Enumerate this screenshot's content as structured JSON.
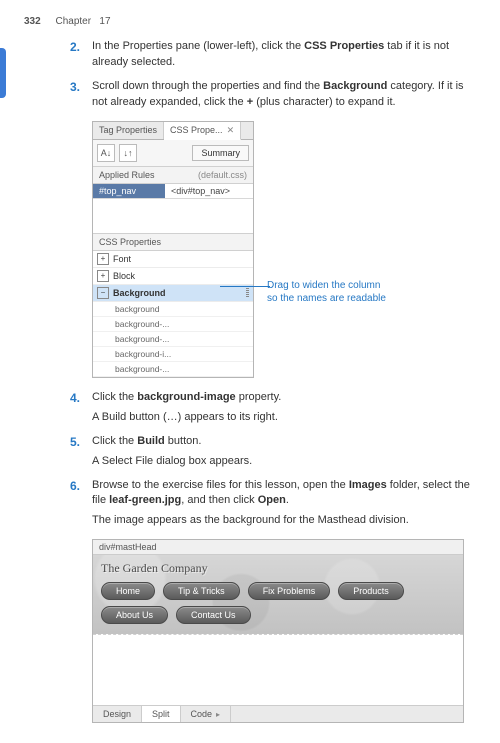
{
  "header": {
    "page_number": "332",
    "chapter": "Chapter",
    "chap_num": "17"
  },
  "steps": [
    {
      "num": "2.",
      "text_a": "In the Properties pane (lower-left), click the ",
      "bold_a": "CSS Properties",
      "text_b": " tab if it is not already selected."
    },
    {
      "num": "3.",
      "text_a": "Scroll down through the properties and find the ",
      "bold_a": "Background",
      "text_b": " category. If it is not already expanded, click the ",
      "bold_b": "+",
      "text_c": " (plus character) to expand it."
    },
    {
      "num": "4.",
      "text_a": "Click the ",
      "bold_a": "background-image",
      "text_b": " property.",
      "sub": "A Build button (…) appears to its right."
    },
    {
      "num": "5.",
      "text_a": "Click the ",
      "bold_a": "Build",
      "text_b": " button.",
      "sub": "A Select File dialog box appears."
    },
    {
      "num": "6.",
      "text_a": "Browse to the exercise files for this lesson, open the ",
      "bold_a": "Images",
      "text_b": " folder, select the file ",
      "bold_b": "leaf-green.jpg",
      "text_c": ", and then click ",
      "bold_c": "Open",
      "text_d": ".",
      "sub": "The image appears as the background for the Masthead division."
    }
  ],
  "panel": {
    "tab1": "Tag Properties",
    "tab2": "CSS Prope...",
    "tab2_close": "✕",
    "sort_icon": "A↓",
    "filter_icon": "↓↑",
    "summary": "Summary",
    "applied_rules_label": "Applied Rules",
    "applied_rules_src": "(default.css)",
    "rule_name": "#top_nav",
    "rule_selector": "<div#top_nav>",
    "css_props_label": "CSS Properties",
    "cats": {
      "font": "Font",
      "block": "Block",
      "background": "Background"
    },
    "subprops": [
      "background",
      "background-...",
      "background-...",
      "background-i...",
      "background-..."
    ]
  },
  "callout": {
    "line1": "Drag to widen the column",
    "line2": "so the names are readable"
  },
  "fig2": {
    "breadcrumb": "div#mastHead",
    "site_title": "The Garden Company",
    "nav": [
      "Home",
      "Tip & Tricks",
      "Fix Problems",
      "Products",
      "About Us",
      "Contact Us"
    ],
    "views": {
      "design": "Design",
      "split": "Split",
      "code": "Code"
    }
  }
}
